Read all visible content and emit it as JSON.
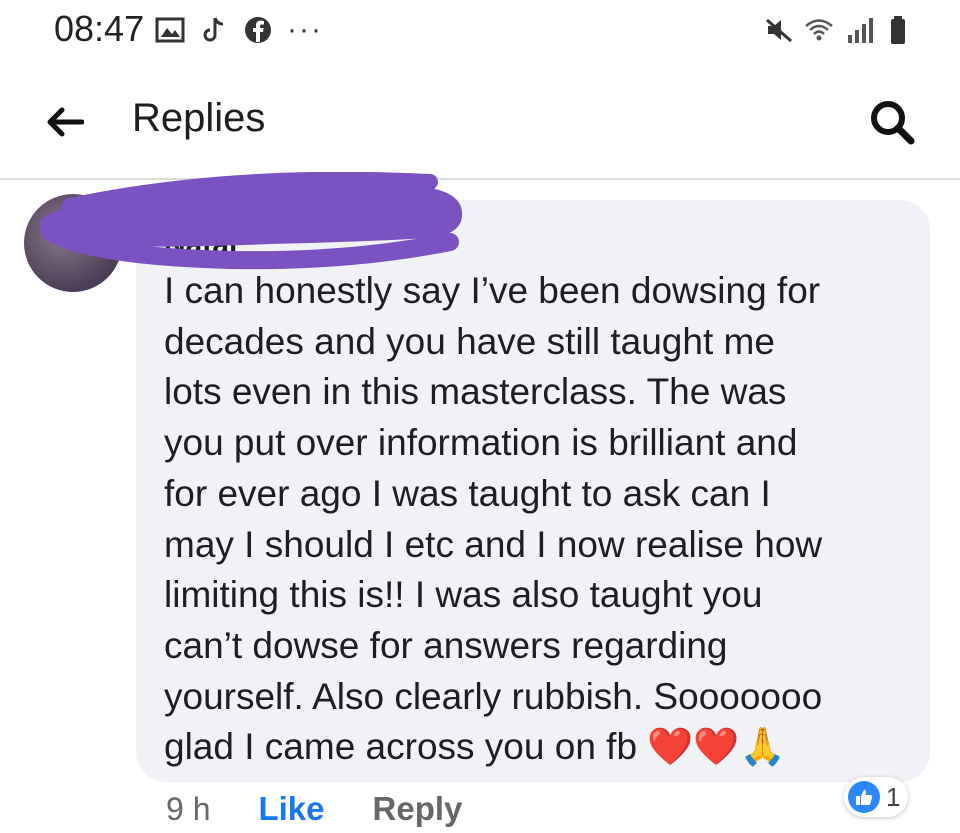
{
  "status_bar": {
    "time": "08:47",
    "left_icons": [
      "gallery-icon",
      "tiktok-icon",
      "facebook-icon"
    ],
    "more_dots": "···",
    "right_icons": [
      "mute-icon",
      "wifi-icon",
      "signal-icon",
      "battery-icon"
    ]
  },
  "header": {
    "title": "Replies",
    "back_icon": "back-arrow-icon",
    "search_icon": "search-icon"
  },
  "comment": {
    "author_visible": "Natal",
    "text": "I can honestly say I’ve been dowsing for\ndecades and you have still taught me\nlots even in this masterclass. The was\nyou put over information is brilliant and\nfor ever ago I was taught to ask can I\nmay I should I etc and I now realise how\nlimiting this is!! I was also taught you\ncan’t dowse for answers regarding\nyourself. Also clearly rubbish. Sooooooo\nglad I came across you on fb ",
    "emojis": "❤️❤️🙏",
    "time_ago": "9 h",
    "like_label": "Like",
    "reply_label": "Reply",
    "reaction_count": "1",
    "colors": {
      "redaction": "#7a52c2",
      "like": "#1877f2",
      "bubble": "#f0f2f5"
    }
  }
}
